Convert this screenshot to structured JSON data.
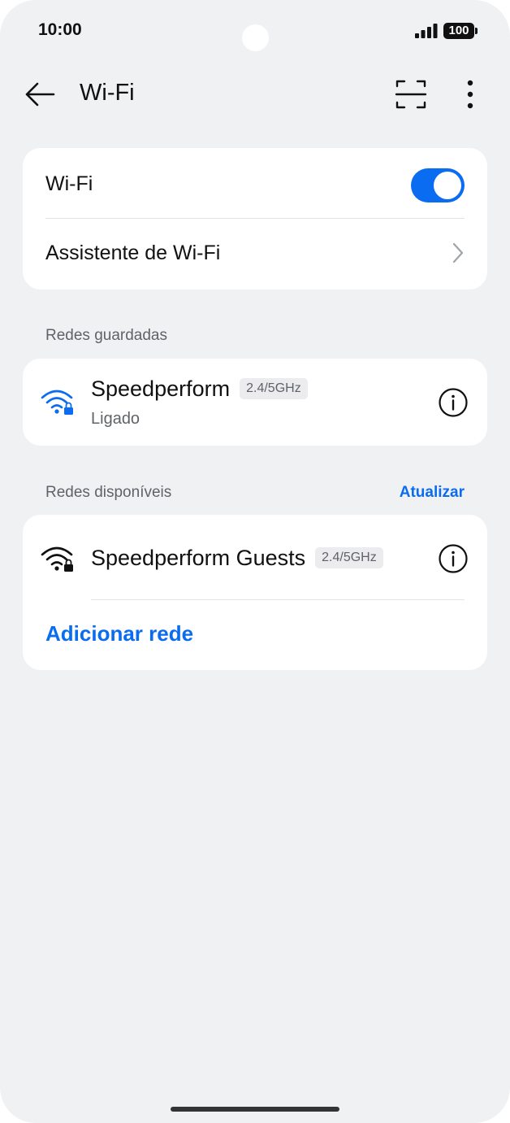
{
  "status_bar": {
    "time": "10:00",
    "battery": "100",
    "icons": [
      "signal-icon",
      "battery-icon"
    ]
  },
  "header": {
    "title": "Wi-Fi",
    "icons": [
      "back-arrow-icon",
      "scan-icon",
      "more-options-icon"
    ]
  },
  "wifi_card": {
    "wifi_label": "Wi-Fi",
    "wifi_enabled": true,
    "assistant_label": "Assistente de Wi-Fi"
  },
  "saved_networks": {
    "section_label": "Redes guardadas",
    "items": [
      {
        "name": "Speedperform",
        "band": "2.4/5GHz",
        "status": "Ligado",
        "icon": "wifi-lock-icon"
      }
    ]
  },
  "available_networks": {
    "section_label": "Redes disponíveis",
    "refresh_label": "Atualizar",
    "items": [
      {
        "name": "Speedperform Guests",
        "band": "2.4/5GHz",
        "icon": "wifi-lock-icon"
      }
    ],
    "add_network_label": "Adicionar rede"
  },
  "colors": {
    "accent": "#0a6cf0",
    "background": "#f0f1f3",
    "card": "#ffffff"
  }
}
